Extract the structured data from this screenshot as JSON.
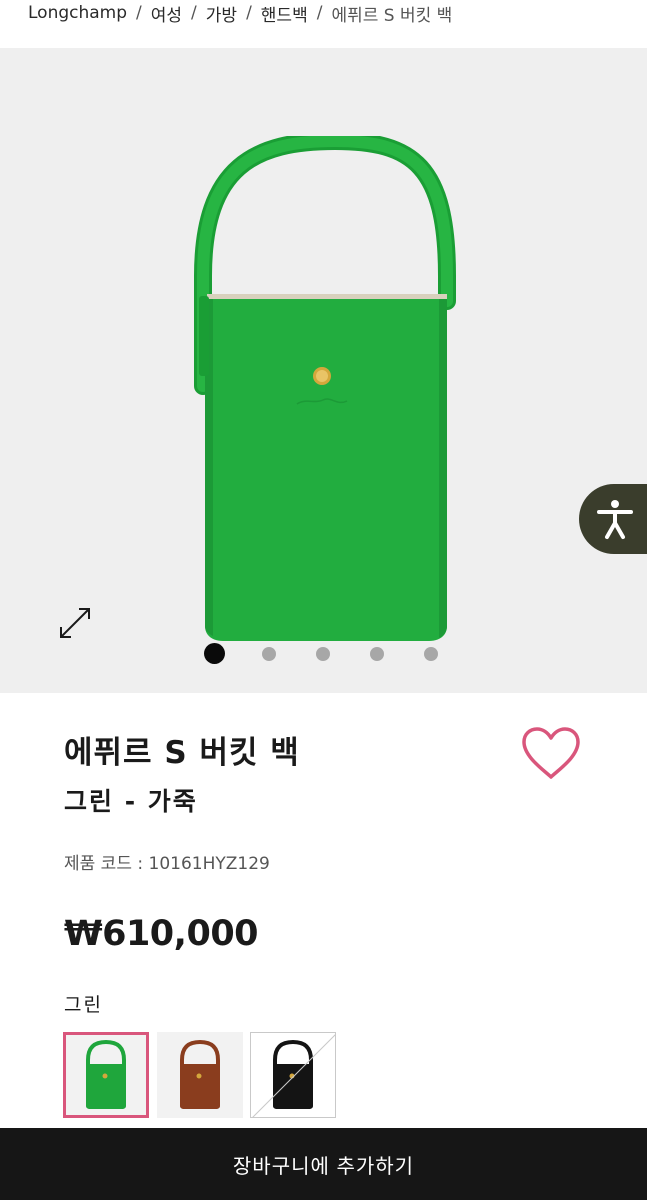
{
  "breadcrumb": {
    "items": [
      {
        "label": "Longchamp"
      },
      {
        "label": "여성"
      },
      {
        "label": "가방"
      },
      {
        "label": "핸드백"
      }
    ],
    "separator": "/",
    "current": "에퓌르 S 버킷 백"
  },
  "gallery": {
    "image_alt": "에퓌르 S 버킷 백 그린",
    "expand_icon": "expand-arrows-icon",
    "dots": [
      true,
      false,
      false,
      false,
      false
    ],
    "background": "#efefef"
  },
  "accessibility": {
    "icon": "accessibility-person-icon",
    "color": "#3a3d2c"
  },
  "product": {
    "title": "에퓌르 S 버킷 백",
    "subtitle": "그린 - 가죽",
    "code": "제품 코드 : 10161HYZ129",
    "price": "₩610,000",
    "color_label": "그린",
    "wishlist_icon": "heart-outline-icon",
    "wishlist_color": "#d9567c"
  },
  "swatches": [
    {
      "color": "#1fa63c",
      "name": "green",
      "selected": true,
      "available": true
    },
    {
      "color": "#8a3d1e",
      "name": "brown",
      "selected": false,
      "available": true
    },
    {
      "color": "#141414",
      "name": "black",
      "selected": false,
      "available": false
    }
  ],
  "cta": {
    "label": "장바구니에 추가하기",
    "background": "#161616"
  }
}
